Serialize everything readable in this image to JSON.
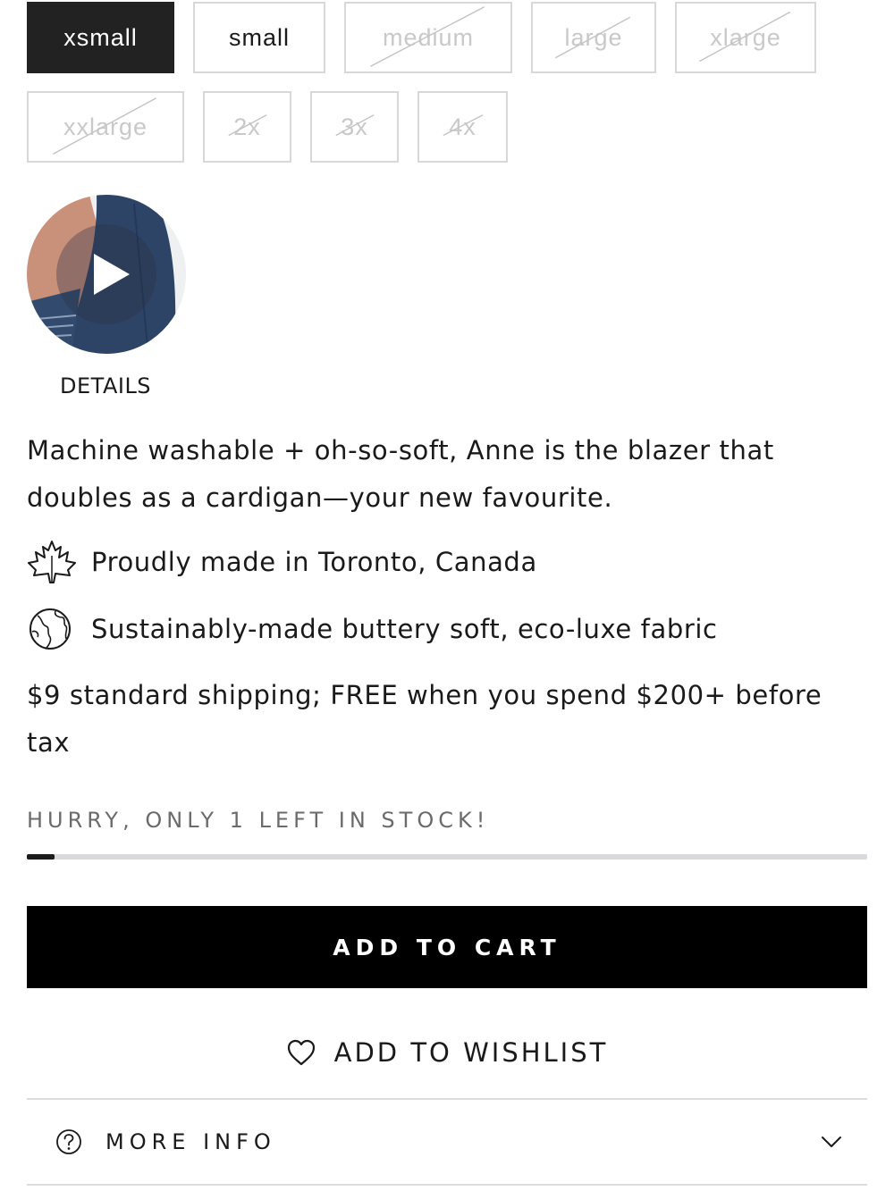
{
  "sizes": {
    "row1": [
      {
        "label": "xsmall",
        "state": "selected"
      },
      {
        "label": "small",
        "state": "available"
      },
      {
        "label": "medium",
        "state": "unavailable"
      },
      {
        "label": "large",
        "state": "unavailable"
      },
      {
        "label": "xlarge",
        "state": "unavailable"
      }
    ],
    "row2": [
      {
        "label": "xxlarge",
        "state": "unavailable"
      },
      {
        "label": "2x",
        "state": "unavailable"
      },
      {
        "label": "3x",
        "state": "unavailable"
      },
      {
        "label": "4x",
        "state": "unavailable"
      }
    ]
  },
  "video": {
    "label": "DETAILS",
    "icon": "play-icon",
    "garment_color": "#2e4466",
    "skin_color": "#c9907a"
  },
  "description": "Machine washable + oh-so-soft, Anne is the blazer that doubles as a cardigan—your new favourite.",
  "features": [
    {
      "icon": "maple-leaf-icon",
      "text": "Proudly made in Toronto, Canada"
    },
    {
      "icon": "globe-icon",
      "text": "Sustainably-made buttery soft, eco-luxe fabric"
    }
  ],
  "shipping": "$9 standard shipping; FREE when you spend $200+ before tax",
  "stock": {
    "text": "HURRY, ONLY 1 LEFT IN STOCK!",
    "level_fraction": 0.033
  },
  "actions": {
    "add_to_cart": "ADD TO CART",
    "add_to_wishlist": "ADD TO WISHLIST"
  },
  "more_info": {
    "label": "MORE INFO",
    "icon": "question-icon",
    "toggle_icon": "chevron-down-icon"
  },
  "colors": {
    "selected_bg": "#222222",
    "button_bg": "#000000",
    "stock_track": "#d9d9de",
    "muted_text": "#6b6b6b"
  }
}
